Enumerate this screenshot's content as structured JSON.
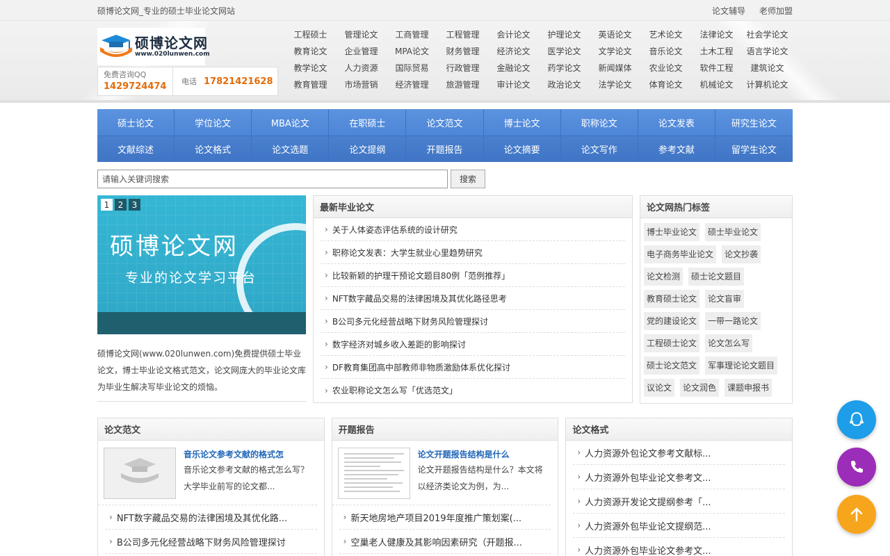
{
  "topbar": {
    "site_title": "硕博论文网_专业的硕士毕业论文网站",
    "links": [
      "论文辅导",
      "老师加盟"
    ]
  },
  "logo": {
    "cn": "硕博论文网",
    "en": "www.020lunwen.com"
  },
  "contact": {
    "qq_label": "免费咨询QQ",
    "qq_number": "1429724474",
    "tel_label": "电话",
    "tel_number": "17821421628"
  },
  "header_links": [
    "工程硕士",
    "管理论文",
    "工商管理",
    "工程管理",
    "会计论文",
    "护理论文",
    "英语论文",
    "艺术论文",
    "法律论文",
    "社会学论文",
    "教育论文",
    "企业管理",
    "MPA论文",
    "财务管理",
    "经济论文",
    "医学论文",
    "文学论文",
    "音乐论文",
    "土木工程",
    "语言学论文",
    "教学论文",
    "人力资源",
    "国际贸易",
    "行政管理",
    "金融论文",
    "药学论文",
    "新闻媒体",
    "农业论文",
    "软件工程",
    "建筑论文",
    "教育管理",
    "市场营销",
    "经济管理",
    "旅游管理",
    "审计论文",
    "政治论文",
    "法学论文",
    "体育论文",
    "机械论文",
    "计算机论文"
  ],
  "nav": {
    "row1": [
      "硕士论文",
      "学位论文",
      "MBA论文",
      "在职硕士",
      "论文范文",
      "博士论文",
      "职称论文",
      "论文发表",
      "研究生论文"
    ],
    "row2": [
      "文献综述",
      "论文格式",
      "论文选题",
      "论文提纲",
      "开题报告",
      "论文摘要",
      "论文写作",
      "参考文献",
      "留学生论文"
    ]
  },
  "search": {
    "placeholder": "请输入关键词搜索",
    "button": "搜索"
  },
  "banner": {
    "pager": [
      "1",
      "2",
      "3"
    ],
    "title": "硕博论文网",
    "subtitle": "专业的论文学习平台",
    "description": "硕博论文网(www.020lunwen.com)免费提供硕士毕业论文，博士毕业论文格式范文，论文网庞大的毕业论文库为毕业生解决写毕业论文的烦恼。"
  },
  "latest": {
    "title": "最新毕业论文",
    "items": [
      "关于人体姿态评估系统的设计研究",
      "职称论文发表：大学生就业心里趋势研究",
      "比较新颖的护理干预论文题目80例「范例推荐」",
      "NFT数字藏品交易的法律困境及其优化路径思考",
      "B公司多元化经营战略下财务风险管理探讨",
      "数字经济对城乡收入差距的影响探讨",
      "DF教育集团高中部教师非物质激励体系优化探讨",
      "农业职称论文怎么写「优选范文」"
    ]
  },
  "tags": {
    "title": "论文网热门标签",
    "items": [
      "博士毕业论文",
      "硕士毕业论文",
      "电子商务毕业论文",
      "论文抄袭",
      "论文检测",
      "硕士论文题目",
      "教育硕士论文",
      "论文盲审",
      "党的建设论文",
      "一带一路论文",
      "工程硕士论文",
      "论文怎么写",
      "硕士论文范文",
      "军事理论论文题目",
      "议论文",
      "论文润色",
      "课题申报书"
    ]
  },
  "boxes": [
    {
      "title": "论文范文",
      "feature_title": "音乐论文参考文献的格式怎",
      "feature_desc": "音乐论文参考文献的格式怎么写？大学毕业前写的论文都...",
      "items": [
        "NFT数字藏品交易的法律困境及其优化路...",
        "B公司多元化经营战略下财务风险管理探讨"
      ]
    },
    {
      "title": "开题报告",
      "feature_title": "论文开题报告结构是什么",
      "feature_desc": "论文开题报告结构是什么？本文将以经济类论文为例，为...",
      "items": [
        "新天地房地产项目2019年度推广策划案(...",
        "空巢老人健康及其影响因素研究（开题报..."
      ]
    },
    {
      "title": "论文格式",
      "items": [
        "人力资源外包论文参考文献标...",
        "人力资源外包毕业论文参考文...",
        "人力资源开发论文提纲参考「...",
        "人力资源外包毕业论文提纲范...",
        "人力资源外包毕业论文参考文..."
      ]
    }
  ]
}
